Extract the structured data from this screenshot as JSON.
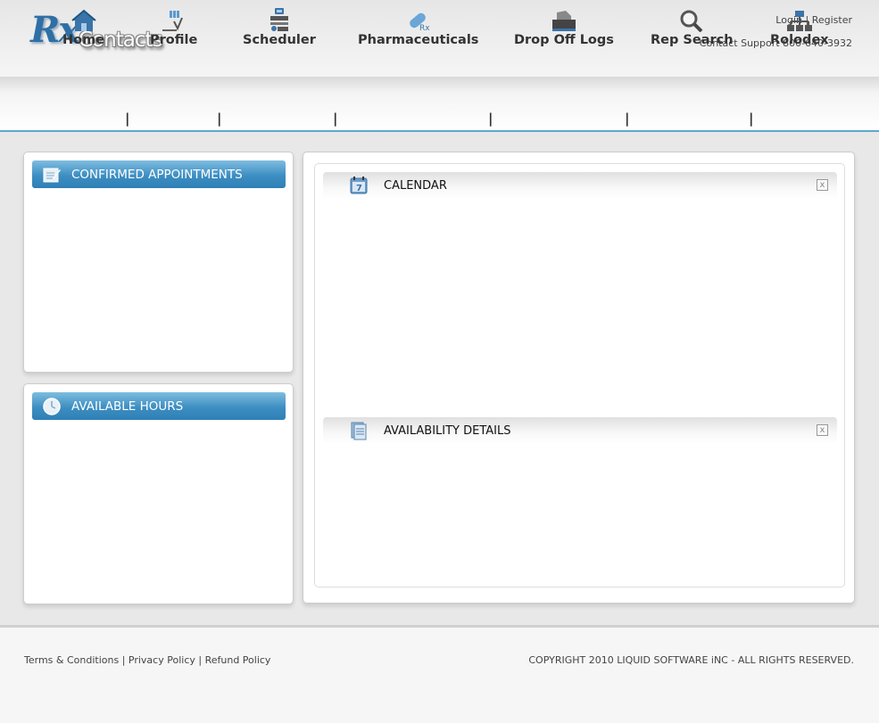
{
  "logo": {
    "rx": "Rx",
    "contacts": "Contacts"
  },
  "top_links": {
    "login": "Login",
    "separator": "|",
    "register": "Register"
  },
  "support": "Contact Support 800-640-3932",
  "nav": {
    "items": [
      {
        "label": "Home",
        "icon": "house-icon"
      },
      {
        "label": "Profile",
        "icon": "profile-icon"
      },
      {
        "label": "Scheduler",
        "icon": "scheduler-icon"
      },
      {
        "label": "Pharmaceuticals",
        "icon": "pill-icon"
      },
      {
        "label": "Drop Off Logs",
        "icon": "drop-off-icon"
      },
      {
        "label": "Rep Search",
        "icon": "magnifier-icon"
      },
      {
        "label": "Rolodex",
        "icon": "org-chart-icon"
      }
    ],
    "separator": "|"
  },
  "left_panels": {
    "confirmed": {
      "title": "CONFIRMED APPOINTMENTS",
      "icon": "notepad-icon"
    },
    "available": {
      "title": "AVAILABLE HOURS",
      "icon": "clock-icon"
    }
  },
  "main": {
    "calendar": {
      "title": "CALENDAR",
      "icon": "calendar-icon",
      "close": "x"
    },
    "availability": {
      "title": "AVAILABILITY DETAILS",
      "icon": "document-icon",
      "close": "x"
    }
  },
  "footer": {
    "terms": "Terms & Conditions",
    "privacy": "Privacy Policy",
    "refund": "Refund Policy",
    "separator": "|",
    "copyright": "COPYRIGHT 2010 LIQUID SOFTWARE iNC - ALL RIGHTS RESERVED."
  },
  "colors": {
    "accent_blue": "#3d8ec2",
    "nav_line": "#5fa7cf",
    "icon_blue": "#3a74a8"
  }
}
